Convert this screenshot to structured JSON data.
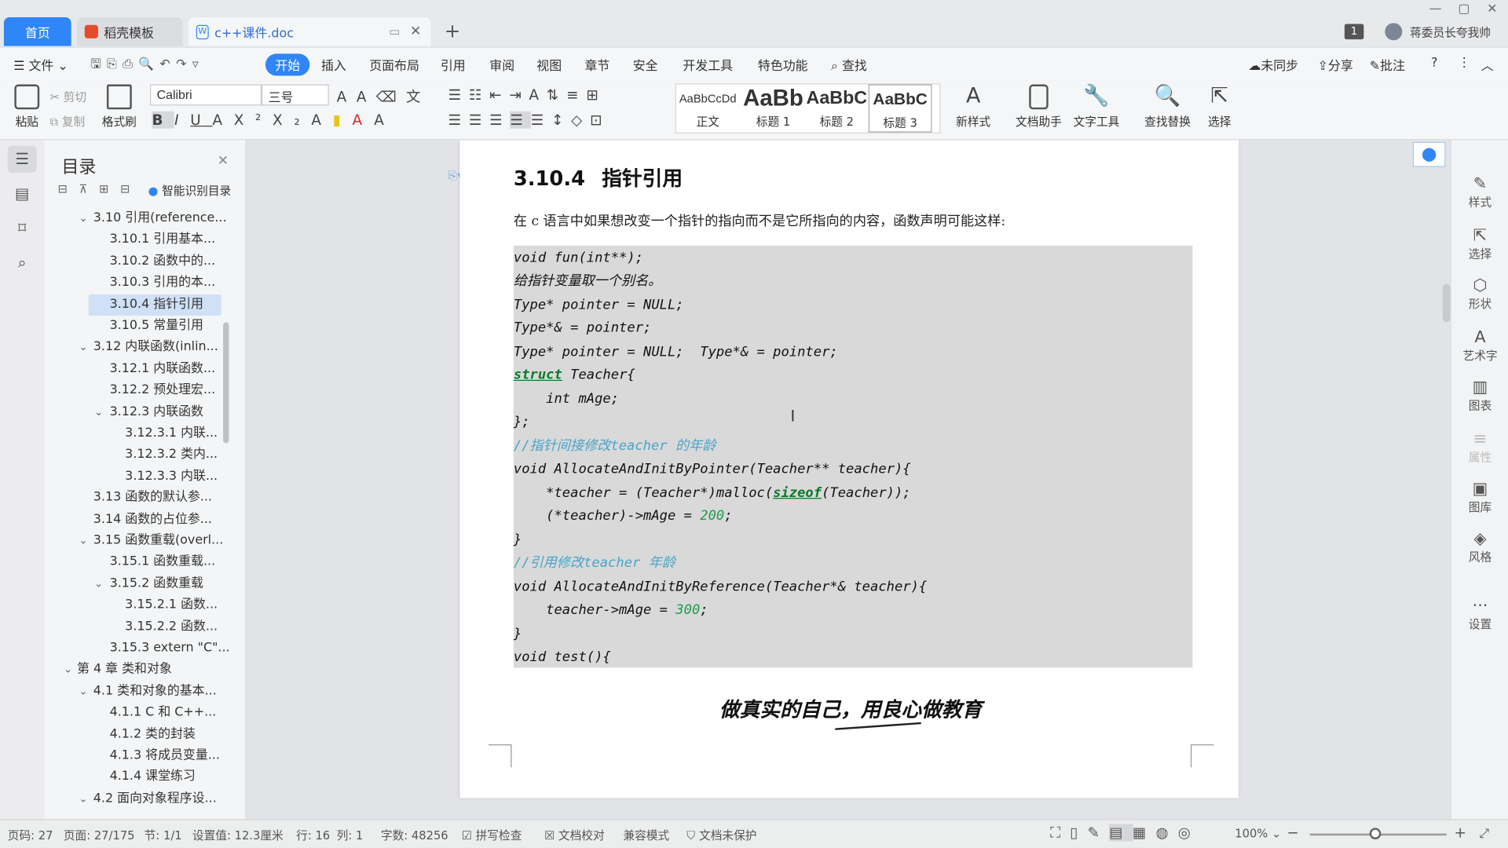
{
  "titlebar": {
    "tabs": [
      {
        "label": "首页"
      },
      {
        "label": "稻壳模板"
      },
      {
        "label": "c++课件.doc"
      }
    ],
    "new_tab_icon": "plus-icon",
    "badge": "1",
    "user": "蒋委员长夸我帅"
  },
  "menubar": {
    "file": "文件",
    "items": [
      "开始",
      "插入",
      "页面布局",
      "引用",
      "审阅",
      "视图",
      "章节",
      "安全",
      "开发工具",
      "特色功能"
    ],
    "search": "查找",
    "sync": "未同步",
    "share": "分享",
    "comment": "批注"
  },
  "ribbon": {
    "paste": "粘贴",
    "cut": "剪切",
    "copy": "复制",
    "format_painter": "格式刷",
    "font_name": "Calibri",
    "font_size": "三号",
    "styles": [
      {
        "preview": "AaBbCcDd",
        "label": "正文"
      },
      {
        "preview": "AaBb",
        "label": "标题 1"
      },
      {
        "preview": "AaBbC",
        "label": "标题 2"
      },
      {
        "preview": "AaBbC",
        "label": "标题 3"
      }
    ],
    "new_style": "新样式",
    "doc_helper": "文档助手",
    "text_tools": "文字工具",
    "find_replace": "查找替换",
    "select": "选择"
  },
  "sidebar": {
    "title": "目录",
    "smart_toc": "智能识别目录",
    "items": [
      {
        "label": "3.10  引用(reference..."
      },
      {
        "label": "3.10.1  引用基本..."
      },
      {
        "label": "3.10.2  函数中的..."
      },
      {
        "label": "3.10.3  引用的本..."
      },
      {
        "label": "3.10.4  指针引用"
      },
      {
        "label": "3.10.5  常量引用"
      },
      {
        "label": "3.12  内联函数(inlin..."
      },
      {
        "label": "3.12.1  内联函数..."
      },
      {
        "label": "3.12.2  预处理宏..."
      },
      {
        "label": "3.12.3  内联函数"
      },
      {
        "label": "3.12.3.1  内联..."
      },
      {
        "label": "3.12.3.2  类内..."
      },
      {
        "label": "3.12.3.3  内联..."
      },
      {
        "label": "3.13  函数的默认参..."
      },
      {
        "label": "3.14  函数的占位参..."
      },
      {
        "label": "3.15  函数重载(overl..."
      },
      {
        "label": "3.15.1  函数重载..."
      },
      {
        "label": "3.15.2  函数重载"
      },
      {
        "label": "3.15.2.1  函数..."
      },
      {
        "label": "3.15.2.2  函数..."
      },
      {
        "label": "3.15.3  extern \"C\"..."
      },
      {
        "label": "第 4 章   类和对象"
      },
      {
        "label": "4.1  类和对象的基本..."
      },
      {
        "label": "4.1.1  C 和 C++..."
      },
      {
        "label": "4.1.2  类的封装"
      },
      {
        "label": "4.1.3  将成员变量..."
      },
      {
        "label": "4.1.4  课堂练习"
      },
      {
        "label": "4.2  面向对象程序设..."
      }
    ]
  },
  "document": {
    "heading_num": "3.10.4",
    "heading_text": "指针引用",
    "intro": "在 c 语言中如果想改变一个指针的指向而不是它所指向的内容，函数声明可能这样:",
    "code": {
      "l1": "void fun(int**);",
      "l2": "给指针变量取一个别名。",
      "l3": "Type* pointer = NULL;",
      "l4": "Type*& = pointer;",
      "l5": "Type* pointer = NULL;  Type*& = pointer;",
      "l6_kw": "struct",
      "l6_rest": " Teacher{",
      "l7": "    int mAge;",
      "l8": "};",
      "l9": "//指针间接修改teacher 的年龄",
      "l10": "void AllocateAndInitByPointer(Teacher** teacher){",
      "l11_a": "    *teacher = (Teacher*)malloc(",
      "l11_kw": "sizeof",
      "l11_b": "(Teacher));",
      "l12_a": "    (*teacher)->mAge = ",
      "l12_num": "200",
      "l12_b": ";",
      "l13": "}",
      "l14": "//引用修改teacher 年龄",
      "l15": "void AllocateAndInitByReference(Teacher*& teacher){",
      "l16_a": "    teacher->mAge = ",
      "l16_num": "300",
      "l16_b": ";",
      "l17": "}",
      "l18": "void test(){"
    },
    "footer_slogan": "做真实的自己，用良心做教育"
  },
  "rightbar": {
    "items": [
      "样式",
      "选择",
      "形状",
      "艺术字",
      "图表",
      "属性",
      "图库",
      "风格",
      "设置"
    ]
  },
  "statusbar": {
    "page_no": "页码: 27",
    "pages": "页面: 27/175",
    "section": "节: 1/1",
    "setting": "设置值: 12.3厘米",
    "line": "行: 16",
    "col": "列: 1",
    "words": "字数: 48256",
    "spell": "拼写检查",
    "proof": "文档校对",
    "compat": "兼容模式",
    "protect": "文档未保护",
    "zoom": "100%"
  },
  "colors": {
    "accent": "#2f86f6",
    "code_bg": "#d9d9d9",
    "comment": "#4aa3c8",
    "keyword": "#0a7a2a"
  }
}
